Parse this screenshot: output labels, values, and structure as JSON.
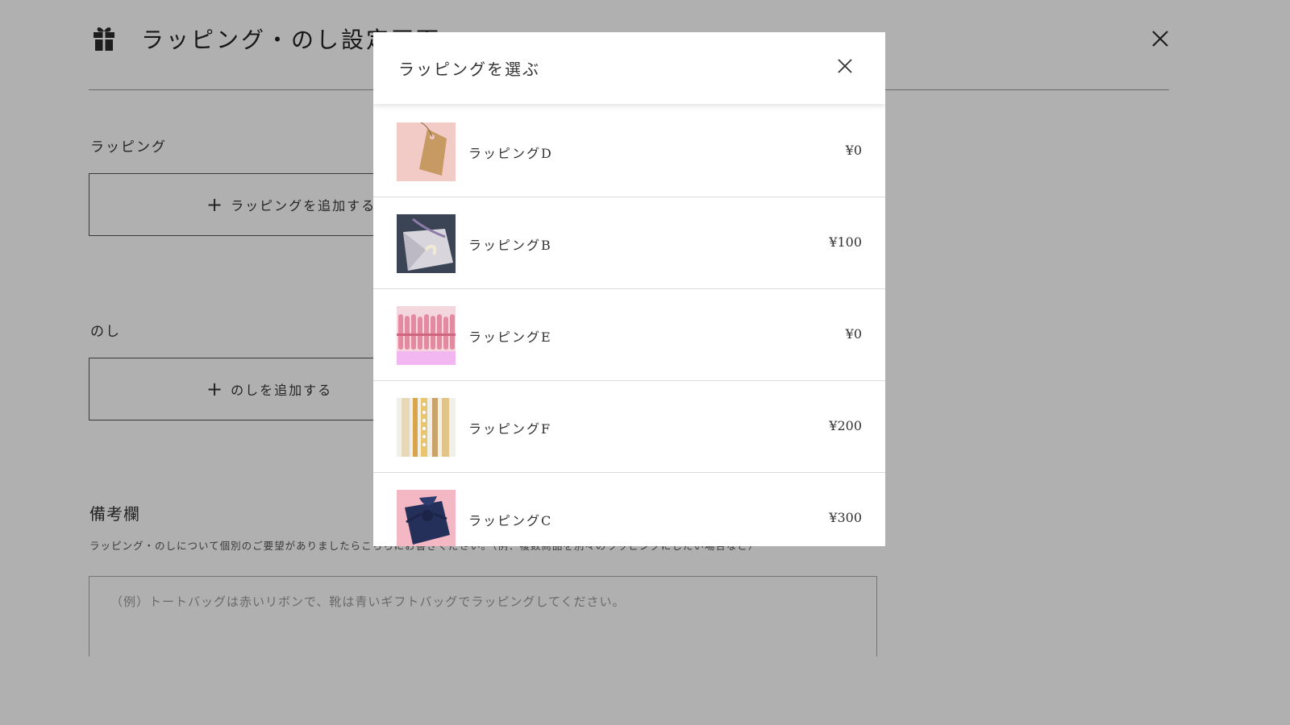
{
  "page": {
    "title": "ラッピング・のし設定画面",
    "wrapping_label": "ラッピング",
    "wrapping_add_label": "ラッピングを追加する",
    "noshi_label": "のし",
    "noshi_add_label": "のしを追加する",
    "notes_title": "備考欄",
    "notes_description": "ラッピング・のしについて個別のご要望がありましたらこちらにお書きください。（例：複数商品を別々のラッピングにしたい場合など）",
    "notes_placeholder": "（例）トートバッグは赤いリボンで、靴は青いギフトバッグでラッピングしてください。",
    "icons": {
      "gift": "gift-icon",
      "close": "close-icon",
      "plus": "plus-icon"
    }
  },
  "modal": {
    "title": "ラッピングを選ぶ",
    "close_icon": "close-icon",
    "items": [
      {
        "name": "ラッピングD",
        "price": "¥0"
      },
      {
        "name": "ラッピングB",
        "price": "¥100"
      },
      {
        "name": "ラッピングE",
        "price": "¥0"
      },
      {
        "name": "ラッピングF",
        "price": "¥200"
      },
      {
        "name": "ラッピングC",
        "price": "¥300"
      }
    ]
  },
  "colors": {
    "overlay": "#000000",
    "text": "#333333",
    "divider": "#dcdcdc"
  }
}
